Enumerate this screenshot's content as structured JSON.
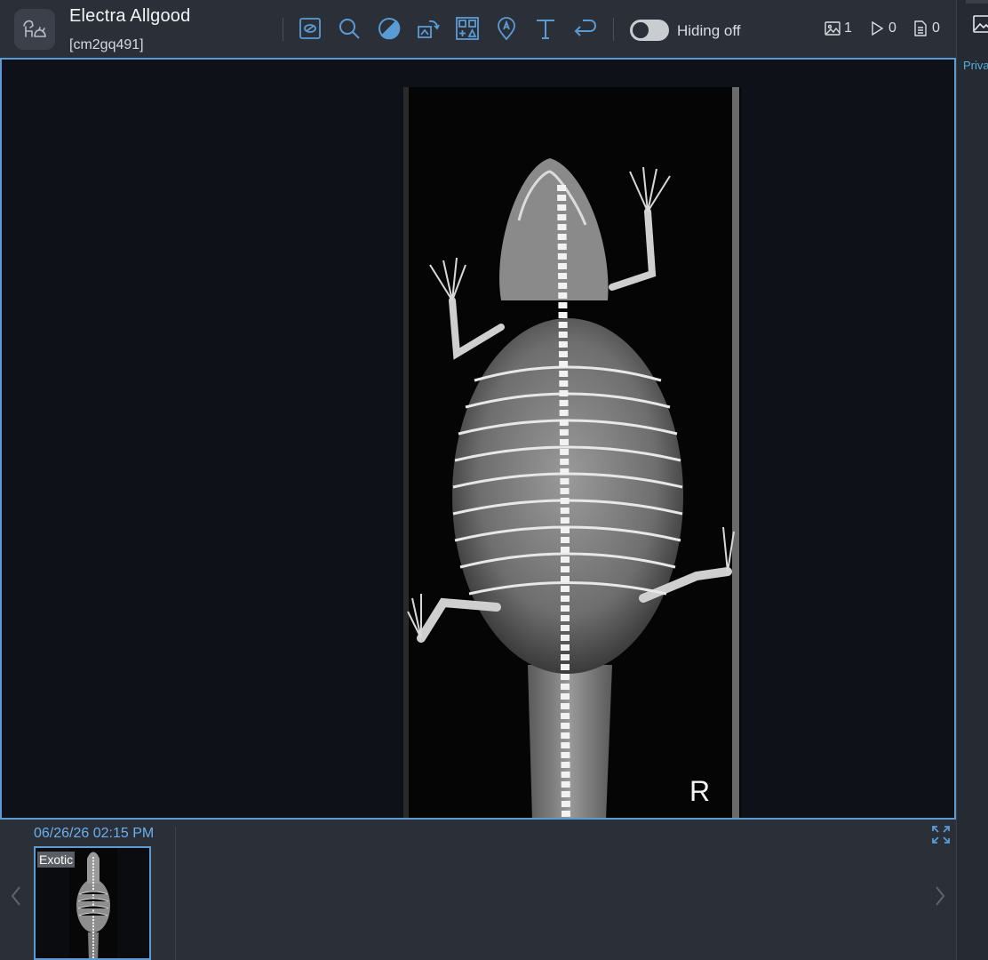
{
  "header": {
    "patient_name": "Electra Allgood",
    "patient_id": "[cm2gq491]",
    "app_logo_icon": "pet-app-logo-icon",
    "toolbar": [
      {
        "name": "window-level-icon"
      },
      {
        "name": "zoom-icon"
      },
      {
        "name": "contrast-icon"
      },
      {
        "name": "rotate-icon"
      },
      {
        "name": "layout-grid-icon"
      },
      {
        "name": "annotation-pin-icon"
      },
      {
        "name": "text-tool-icon"
      },
      {
        "name": "undo-icon"
      }
    ],
    "hiding_toggle": {
      "label": "Hiding off",
      "state": "off"
    },
    "counts": {
      "images": "1",
      "videos": "0",
      "reports": "0"
    }
  },
  "right_panel": {
    "label": "Priva"
  },
  "viewer": {
    "marker": "R"
  },
  "thumbnails": {
    "study_date": "06/26/26 02:15 PM",
    "items": [
      {
        "label": "Exotic"
      }
    ]
  },
  "colors": {
    "accent": "#5b9bd5",
    "background": "#2b2f38",
    "viewer_bg": "#0e1117",
    "date_text": "#6ab0ee"
  }
}
